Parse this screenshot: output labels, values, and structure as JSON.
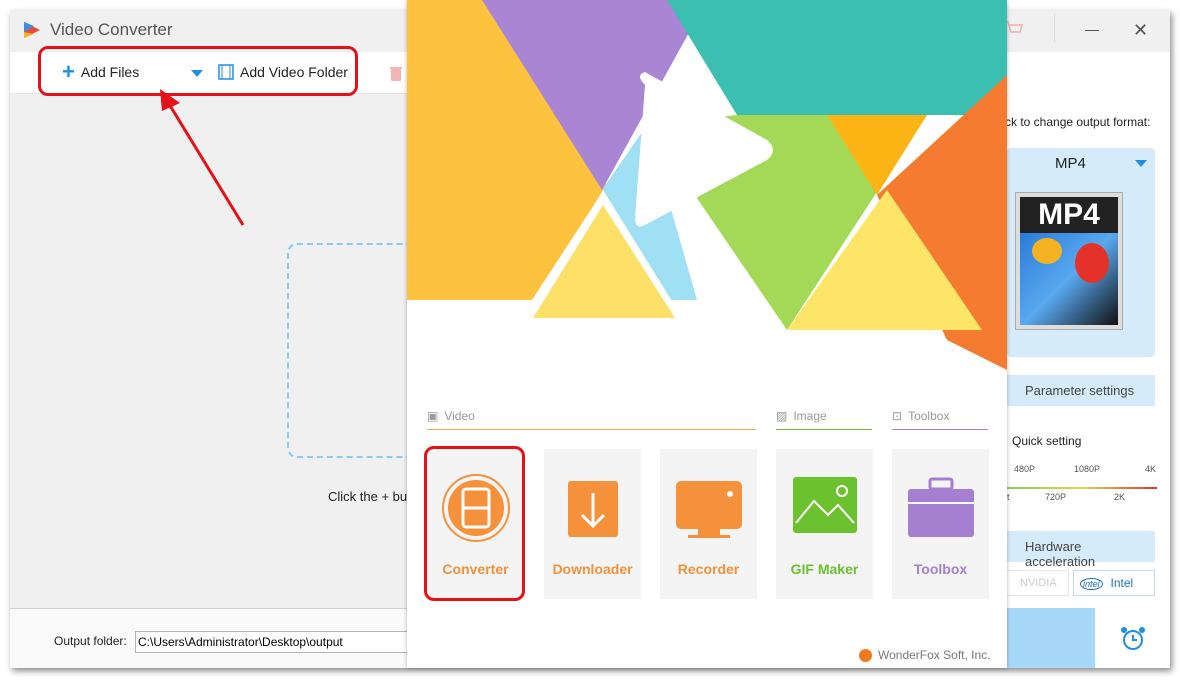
{
  "window": {
    "title": "Video Converter"
  },
  "toolbar": {
    "add_files": "Add Files",
    "add_video_folder": "Add Video Folder"
  },
  "main": {
    "hint": "Click the + bu",
    "output_folder_label": "Output folder:",
    "output_folder_value": "C:\\Users\\Administrator\\Desktop\\output"
  },
  "right_panel": {
    "format_prompt": "ck to change output format:",
    "format": "MP4",
    "format_thumb_label": "MP4",
    "parameter_settings": "Parameter settings",
    "quick_setting": "Quick setting",
    "quality_top": [
      "480P",
      "1080P",
      "4K"
    ],
    "quality_bottom": [
      "lt",
      "720P",
      "2K"
    ],
    "hardware_acceleration": "Hardware acceleration",
    "gpu_nvidia": "NVIDIA",
    "gpu_intel": "Intel",
    "gpu_intel_logo": "intel"
  },
  "splash": {
    "categories": {
      "video": "Video",
      "image": "Image",
      "toolbox": "Toolbox"
    },
    "tiles": [
      {
        "label": "Converter",
        "color": "#f5903b",
        "icon": "converter-film-icon"
      },
      {
        "label": "Downloader",
        "color": "#f5903b",
        "icon": "download-film-icon"
      },
      {
        "label": "Recorder",
        "color": "#f5903b",
        "icon": "screen-record-icon"
      },
      {
        "label": "GIF Maker",
        "color": "#6cc12e",
        "icon": "image-mountain-icon"
      },
      {
        "label": "Toolbox",
        "color": "#a57fd0",
        "icon": "toolbox-icon"
      }
    ],
    "footer": "WonderFox Soft, Inc."
  },
  "colors": {
    "highlight": "#e5101a",
    "accent": "#1e90e0",
    "panel_blue": "#d6ebfa"
  }
}
